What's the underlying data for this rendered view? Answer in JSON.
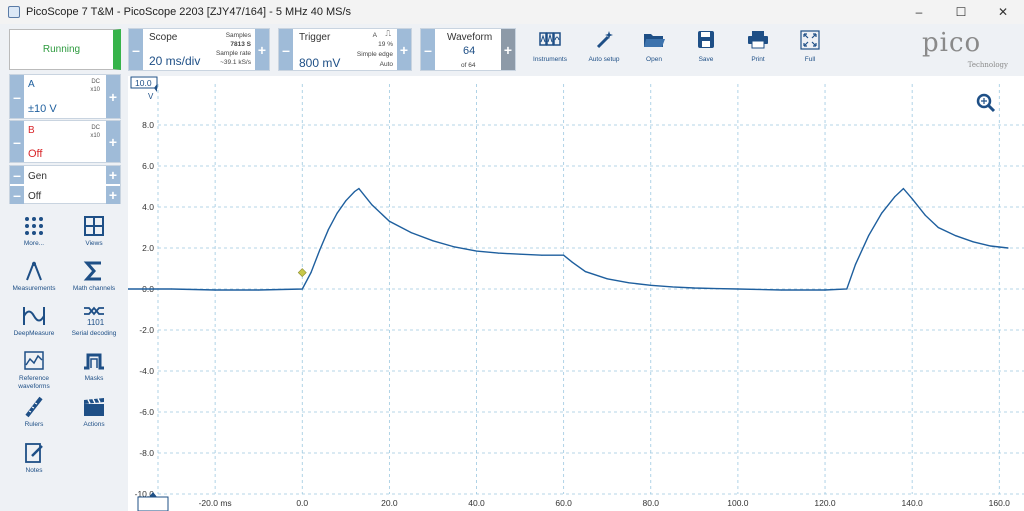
{
  "window": {
    "title": "PicoScope 7 T&M  - PicoScope 2203 [ZJY47/164] - 5 MHz 40 MS/s",
    "minimize": "–",
    "maximize": "☐",
    "close": "✕"
  },
  "status": {
    "running_label": "Running"
  },
  "scope": {
    "label": "Scope",
    "timebase": "20 ms/div",
    "samples_label": "Samples",
    "samples": "7813 S",
    "sample_rate_label": "Sample rate",
    "sample_rate": "~39.1 kS/s"
  },
  "trigger": {
    "label": "Trigger",
    "level": "800 mV",
    "channel": "A",
    "pre": "19 %",
    "type": "Simple edge",
    "mode": "Auto"
  },
  "waveform": {
    "label": "Waveform",
    "current": "64",
    "of": "of 64"
  },
  "toolbar": {
    "instruments": "Instruments",
    "auto_setup": "Auto setup",
    "open": "Open",
    "save": "Save",
    "print": "Print",
    "full": "Full"
  },
  "logo": {
    "name": "pico",
    "sub": "Technology"
  },
  "channels": [
    {
      "name": "A",
      "coupling": "DC",
      "probe": "x10",
      "range": "±10 V",
      "color": "#1e5f9e"
    },
    {
      "name": "B",
      "coupling": "DC",
      "probe": "x10",
      "range": "Off",
      "color": "#d9262a"
    }
  ],
  "generator": {
    "label": "Gen",
    "state": "Off"
  },
  "tools": {
    "more": "More...",
    "views": "Views",
    "measurements": "Measurements",
    "math_channels": "Math channels",
    "deep_measure": "DeepMeasure",
    "serial_decoding": "Serial decoding",
    "reference_waveforms_line1": "Reference",
    "reference_waveforms_line2": "waveforms",
    "masks": "Masks",
    "rulers": "Rulers",
    "actions": "Actions",
    "notes": "Notes"
  },
  "axis": {
    "y_unit": "V",
    "y_top_tag": "10.0",
    "y_ticks": [
      "8.0",
      "6.0",
      "4.0",
      "2.0",
      "0.0",
      "-2.0",
      "-4.0",
      "-6.0",
      "-8.0",
      "-10.0"
    ],
    "x_ticks": [
      "-20.0 ms",
      "0.0",
      "20.0",
      "40.0",
      "60.0",
      "80.0",
      "100.0",
      "120.0",
      "140.0",
      "160.0"
    ]
  },
  "chart_data": {
    "type": "line",
    "xlabel": "ms",
    "ylabel": "V",
    "xlim": [
      -40,
      162
    ],
    "ylim": [
      -10,
      10
    ],
    "grid": true,
    "series": [
      {
        "color": "#1e5f9e",
        "x": [
          -40,
          -30,
          -20,
          -10,
          0,
          2,
          4,
          6,
          8,
          10,
          12,
          13,
          16,
          20,
          25,
          30,
          35,
          40,
          45,
          50,
          55,
          60,
          62,
          65,
          70,
          75,
          80,
          85,
          90,
          95,
          100,
          110,
          120,
          125,
          127,
          130,
          133,
          136,
          138,
          140,
          143,
          146,
          150,
          154,
          158,
          162
        ],
        "y": [
          0.0,
          0.0,
          -0.05,
          -0.05,
          0.0,
          0.8,
          1.9,
          2.9,
          3.7,
          4.3,
          4.75,
          4.9,
          4.1,
          3.3,
          2.75,
          2.35,
          2.05,
          1.85,
          1.75,
          1.7,
          1.65,
          1.65,
          1.3,
          0.85,
          0.5,
          0.3,
          0.18,
          0.1,
          0.05,
          0.02,
          0.0,
          -0.05,
          -0.05,
          0.0,
          1.2,
          2.6,
          3.7,
          4.5,
          4.9,
          4.4,
          3.6,
          3.0,
          2.6,
          2.3,
          2.1,
          2.0
        ]
      }
    ],
    "trigger_marker": {
      "x": 0.0,
      "y": 0.8,
      "color": "#c8c84a"
    }
  }
}
